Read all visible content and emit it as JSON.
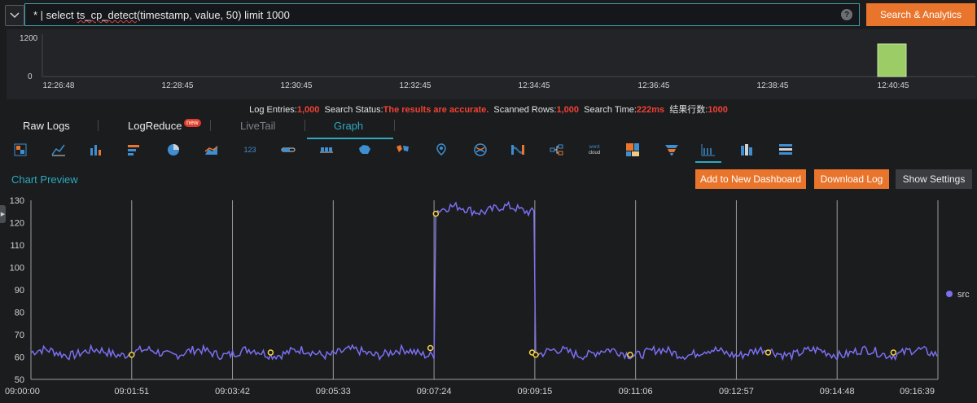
{
  "query": {
    "prefix": "* | select ",
    "function_name": "ts_cp_detect",
    "suffix": "(timestamp, value, 50) limit 1000",
    "help_icon": "?"
  },
  "search_button": "Search & Analytics",
  "histogram": {
    "ymax_label": "1200",
    "ymin_label": "0",
    "ticks": [
      "12:26:48",
      "12:28:45",
      "12:30:45",
      "12:32:45",
      "12:34:45",
      "12:36:45",
      "12:38:45",
      "12:40:45"
    ],
    "bar_value": 1000,
    "bar_color": "#9ccc65"
  },
  "stats": {
    "entries_label": "Log Entries:",
    "entries_value": "1,000",
    "status_label": "Search Status:",
    "status_value": "The results are accurate.",
    "rows_label": "Scanned Rows:",
    "rows_value": "1,000",
    "time_label": "Search Time:",
    "time_value": "222ms",
    "result_rows_label": "结果行数:",
    "result_rows_value": "1000"
  },
  "tabs": [
    {
      "label": "Raw Logs"
    },
    {
      "label": "LogReduce",
      "badge": "new"
    },
    {
      "label": "LiveTail"
    },
    {
      "label": "Graph"
    }
  ],
  "chart_icons": [
    "table-chart-icon",
    "line-chart-icon",
    "bar-chart-icon",
    "horizontal-bar-icon",
    "pie-chart-icon",
    "area-chart-icon",
    "single-value-icon",
    "progress-bar-icon",
    "flow-icon",
    "china-map-icon",
    "world-map-icon",
    "amap-icon",
    "chord-icon",
    "sankey-icon",
    "tree-icon",
    "word-cloud-icon",
    "treemap-icon",
    "funnel-icon",
    "time-series-icon",
    "column-icon",
    "cross-table-icon"
  ],
  "icon_text": {
    "single_value": "123",
    "word_cloud": "word cloud"
  },
  "preview_title": "Chart Preview",
  "buttons": {
    "add_dashboard": "Add to New Dashboard",
    "download_log": "Download Log",
    "show_settings": "Show Settings"
  },
  "chart_data": {
    "type": "line",
    "series": [
      {
        "name": "src",
        "color": "#7b6ff2"
      }
    ],
    "x_ticks": [
      "09:00:00",
      "09:01:51",
      "09:03:42",
      "09:05:33",
      "09:07:24",
      "09:09:15",
      "09:11:06",
      "09:12:57",
      "09:14:48",
      "09:16:39"
    ],
    "y_ticks": [
      "130",
      "120",
      "110",
      "100",
      "90",
      "80",
      "70",
      "60",
      "50"
    ],
    "ylim": [
      50,
      130
    ],
    "x_range_seconds": [
      0,
      999
    ],
    "baseline_level": 62,
    "high_level": 126,
    "high_segment_seconds": [
      445,
      555
    ],
    "change_points": [
      {
        "t": 111,
        "v": 61
      },
      {
        "t": 264,
        "v": 62
      },
      {
        "t": 440,
        "v": 64
      },
      {
        "t": 446,
        "v": 124
      },
      {
        "t": 552,
        "v": 62
      },
      {
        "t": 556,
        "v": 61
      },
      {
        "t": 660,
        "v": 61
      },
      {
        "t": 812,
        "v": 62
      },
      {
        "t": 950,
        "v": 62
      }
    ],
    "change_point_color": "#f5d442",
    "grid_color": "#9a9da3",
    "legend_position": "right"
  }
}
